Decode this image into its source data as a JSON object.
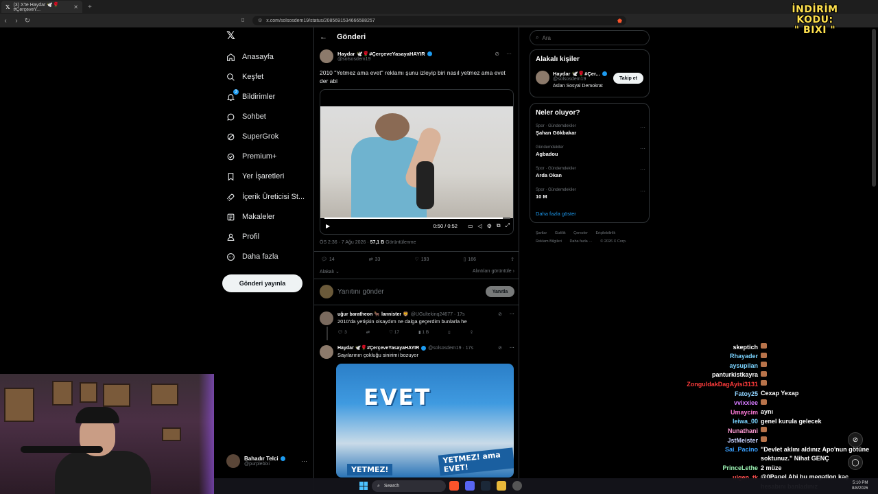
{
  "browser": {
    "tab_title": "(3) X'te Haydar 🕊️🌹#ÇerçeveY...",
    "url": "x.com/solsosdem19/status/2085691534666588257",
    "promo_line1": "İNDİRİM KODU:",
    "promo_line2": "\" BIXI \""
  },
  "nav": {
    "items": [
      {
        "label": "Anasayfa",
        "icon": "home-icon"
      },
      {
        "label": "Keşfet",
        "icon": "search-icon"
      },
      {
        "label": "Bildirimler",
        "icon": "bell-icon",
        "badge": "3"
      },
      {
        "label": "Sohbet",
        "icon": "chat-icon"
      },
      {
        "label": "SuperGrok",
        "icon": "grok-icon"
      },
      {
        "label": "Premium+",
        "icon": "premium-icon"
      },
      {
        "label": "Yer İşaretleri",
        "icon": "bookmark-icon"
      },
      {
        "label": "İçerik Üreticisi St...",
        "icon": "rocket-icon"
      },
      {
        "label": "Makaleler",
        "icon": "article-icon"
      },
      {
        "label": "Profil",
        "icon": "profile-icon"
      },
      {
        "label": "Daha fazla",
        "icon": "more-circle-icon"
      }
    ],
    "post_button": "Gönderi yayınla",
    "account_name": "Bahadır Telci",
    "account_handle": "@purplebixi"
  },
  "main": {
    "header_title": "Gönderi",
    "post": {
      "author": "Haydar 🕊️🌹#ÇerçeveYasayaHAYIR",
      "handle": "@solsosdem19",
      "text": "2010 \"Yetmez ama evet\" reklamı şunu izleyip biri nasıl yetmez ama evet der abi",
      "video_time": "0:50 / 0:52",
      "video_progress": 0.96,
      "meta_time": "ÖS 2:36 · 7 Ağu 2026 · ",
      "meta_views": "57,1 B",
      "meta_views_label": " Görüntülenme",
      "replies": "14",
      "reposts": "33",
      "likes": "193",
      "bookmarks": "166",
      "related": "Alakalı",
      "quotes": "Alıntıları görüntüle"
    },
    "reply_placeholder": "Yanıtını gönder",
    "reply_button": "Yanıtla",
    "replies": [
      {
        "author": "uğur baratheon 🐂 lannister 🦁",
        "handle": "@UGultekinq24677 · 17s",
        "text": "2010'da yetişkin olsaydım ne dalga geçerdim bunlarla he",
        "replies": "3",
        "likes": "17",
        "views": "1 B"
      },
      {
        "author": "Haydar 🕊️🌹#ÇerçeveYasayaHAYIR",
        "handle": "@solsosdem19 · 17s",
        "text": "Sayılarının çokluğu sinirimi bozuyor",
        "image_text": "EVET",
        "banner1": "YETMEZ! ama EVET!",
        "banner2": "YETMEZ!"
      }
    ]
  },
  "right": {
    "search_placeholder": "Ara",
    "related_title": "Alakalı kişiler",
    "person_name": "Haydar 🕊️🌹#Çer...",
    "person_handle": "@solsosdem19",
    "person_bio": "Aslan Sosyal Demokrat",
    "follow_button": "Takip et",
    "trends_title": "Neler oluyor?",
    "trends": [
      {
        "category": "Spor · Gündemdekiler",
        "name": "Şahan Gökbakar"
      },
      {
        "category": "Gündemdekiler",
        "name": "Agbadou"
      },
      {
        "category": "Spor · Gündemdekiler",
        "name": "Arda Okan"
      },
      {
        "category": "Spor · Gündemdekiler",
        "name": "10 M"
      }
    ],
    "show_more": "Daha fazla göster",
    "footer": [
      "Şartlar",
      "Gizlilik",
      "Çerezler",
      "Erişilebilirlik",
      "Reklam Bilgileri",
      "Daha fazla ···",
      "© 2026 X Corp."
    ]
  },
  "chat": [
    {
      "user": "skeptich",
      "color": "#ffffff",
      "msg": ""
    },
    {
      "user": "Rhayader",
      "color": "#7ad3ff",
      "msg": ""
    },
    {
      "user": "aysupilan",
      "color": "#7ad3ff",
      "msg": ""
    },
    {
      "user": "panturkistkayra",
      "color": "#ffffff",
      "msg": ""
    },
    {
      "user": "ZonguldakDagAyisi3131",
      "color": "#ff3b3b",
      "msg": ""
    },
    {
      "user": "Fatoy25",
      "color": "#8fd3ff",
      "msg": "Cexap Yexap"
    },
    {
      "user": "vvixxiee",
      "color": "#d77bff",
      "msg": ""
    },
    {
      "user": "Umaycim",
      "color": "#ff7ad9",
      "msg": "aynı"
    },
    {
      "user": "leiwa_00",
      "color": "#7ad3ff",
      "msg": "genel kurula gelecek"
    },
    {
      "user": "Nunathani",
      "color": "#ff9bd6",
      "msg": ""
    },
    {
      "user": "JstMeister",
      "color": "#c7d2ff",
      "msg": ""
    },
    {
      "user": "Sai_Pacino",
      "color": "#3aa0ff",
      "msg": "\"Devlet aklını aldınız Apo'nun götüne"
    },
    {
      "user": "",
      "color": "#ffffff",
      "msg": "soktunuz.\" Nihat GENÇ"
    },
    {
      "user": "PrinceLethe",
      "color": "#9cf4b4",
      "msg": "2 müze"
    },
    {
      "user": "ulgen_tk",
      "color": "#ff4f4f",
      "msg": "@0Papel Abi bu megatlon kaç"
    },
    {
      "user": "",
      "color": "#ffffff",
      "msg": "hesabını banladınız"
    }
  ],
  "taskbar": {
    "search_label": "Search",
    "time": "5:10 PM",
    "date": "8/8/2026"
  }
}
